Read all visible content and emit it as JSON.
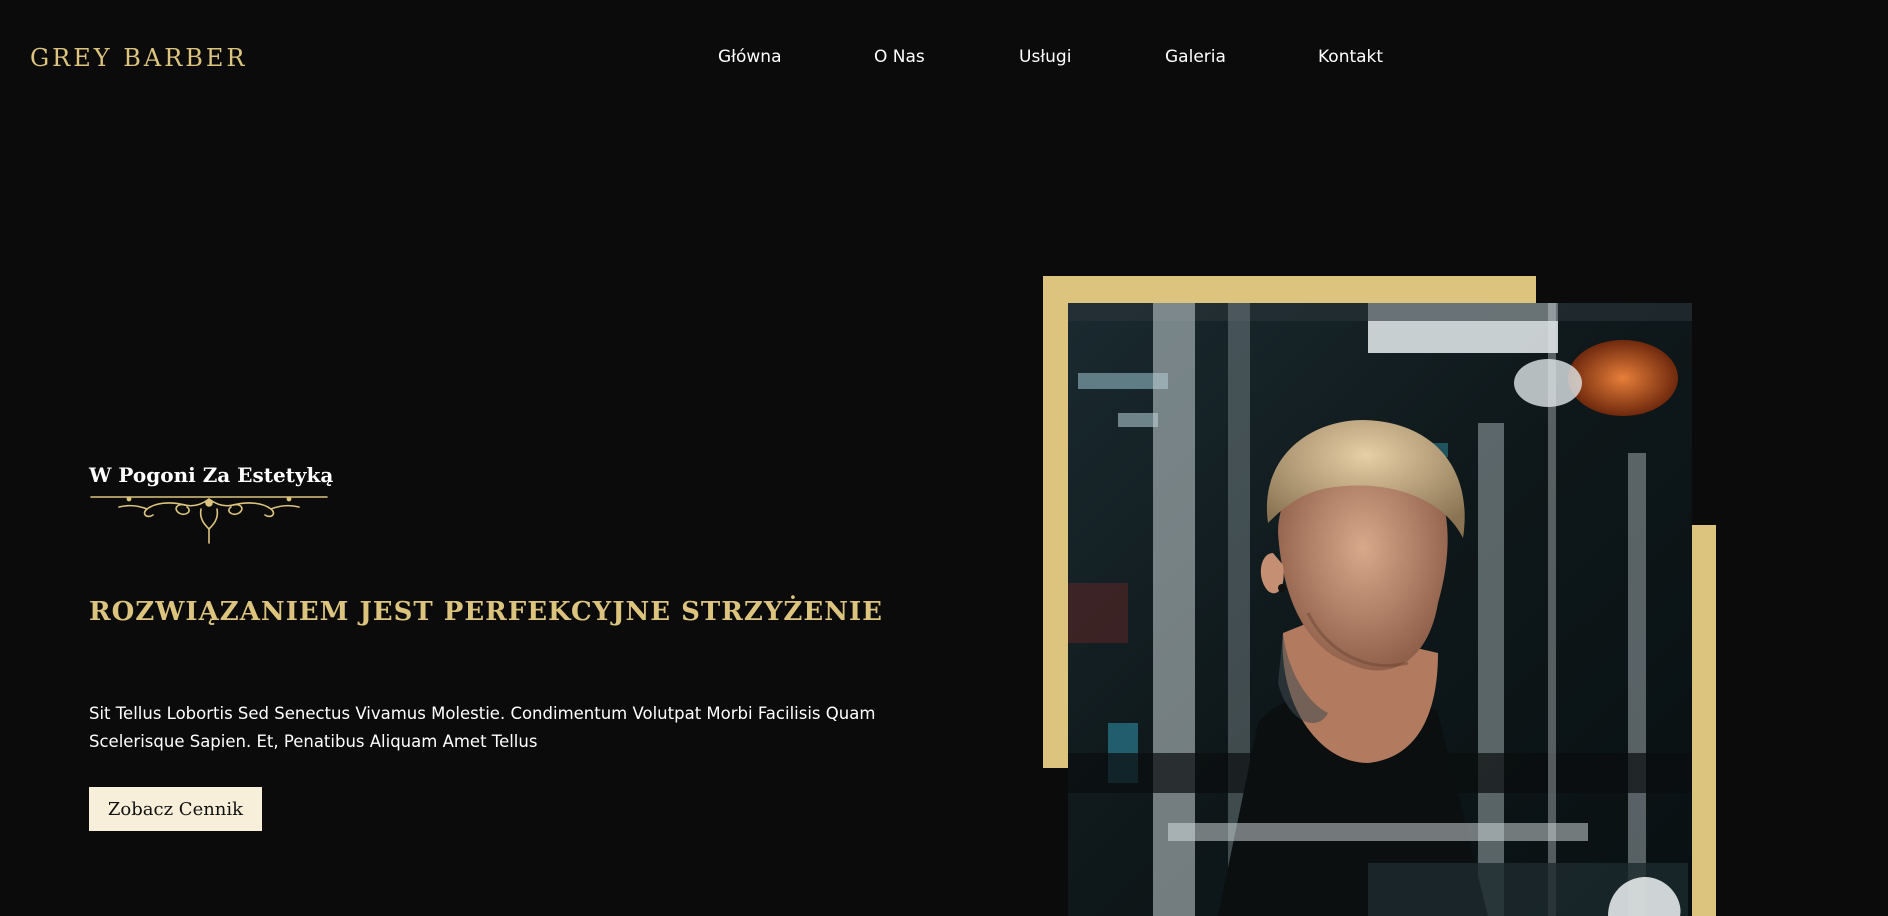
{
  "brand": {
    "name": "GREY BARBER",
    "accent_color": "#dcc47f",
    "background_color": "#0b0b0b"
  },
  "nav": {
    "items": [
      {
        "label": "Główna"
      },
      {
        "label": "O Nas"
      },
      {
        "label": "Usługi"
      },
      {
        "label": "Galeria"
      },
      {
        "label": "Kontakt"
      }
    ]
  },
  "hero": {
    "tagline": "W Pogoni Za Estetyką",
    "headline": "ROZWIĄZANIEM JEST PERFEKCYJNE STRZYŻENIE",
    "description": "Sit Tellus Lobortis Sed Senectus Vivamus Molestie. Condimentum Volutpat Morbi Facilisis Quam Scelerisque Sapien. Et, Penatibus Aliquam Amet Tellus",
    "cta_label": "Zobacz Cennik",
    "cta_background": "#f7efd9"
  },
  "icons": {
    "ornament": "flourish-divider-icon"
  }
}
